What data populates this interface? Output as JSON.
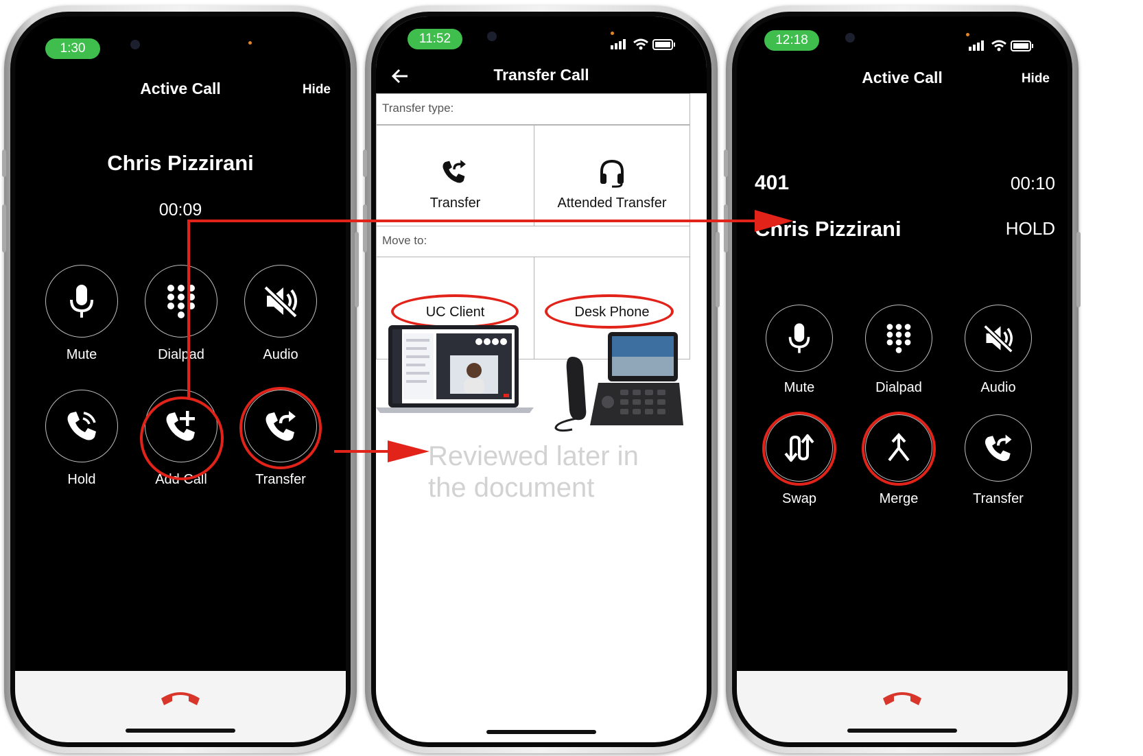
{
  "phone1": {
    "time": "1:30",
    "title": "Active Call",
    "hide": "Hide",
    "caller": "Chris Pizzirani",
    "timer": "00:09",
    "buttons": {
      "mute": "Mute",
      "dialpad": "Dialpad",
      "audio": "Audio",
      "hold": "Hold",
      "add_call": "Add Call",
      "transfer": "Transfer"
    }
  },
  "phone2": {
    "time": "11:52",
    "title": "Transfer Call",
    "transfer_type_label": "Transfer type:",
    "transfer_option": "Transfer",
    "attended_option": "Attended Transfer",
    "move_to_label": "Move to:",
    "uc_client": "UC Client",
    "desk_phone": "Desk Phone",
    "note_line1": "Reviewed later in",
    "note_line2": "the document"
  },
  "phone3": {
    "time": "12:18",
    "title": "Active Call",
    "hide": "Hide",
    "active_number": "401",
    "active_timer": "00:10",
    "held_caller": "Chris Pizzirani",
    "held_status": "HOLD",
    "buttons": {
      "mute": "Mute",
      "dialpad": "Dialpad",
      "audio": "Audio",
      "swap": "Swap",
      "merge": "Merge",
      "transfer": "Transfer"
    }
  },
  "colors": {
    "highlight": "#e2231a",
    "status_pill": "#3fbe4e",
    "end_call": "#d9362b"
  }
}
